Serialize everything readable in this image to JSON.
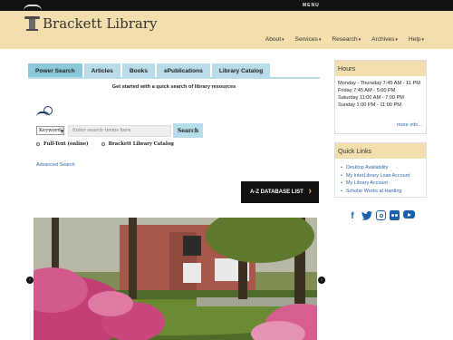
{
  "topbar": {
    "menu_label": "MENU"
  },
  "header": {
    "title": "Brackett Library"
  },
  "nav": [
    {
      "label": "About"
    },
    {
      "label": "Services"
    },
    {
      "label": "Research"
    },
    {
      "label": "Archives"
    },
    {
      "label": "Help"
    }
  ],
  "search": {
    "tabs": [
      {
        "label": "Power Search",
        "active": true
      },
      {
        "label": "Articles"
      },
      {
        "label": "Books"
      },
      {
        "label": "ePublications"
      },
      {
        "label": "Library Catalog"
      }
    ],
    "tagline": "Get started with a quick search of library resources",
    "field_select": "Keyword",
    "input_placeholder": "Enter search terms here",
    "button_label": "Search",
    "options": [
      {
        "label": "Full-Text (online)"
      },
      {
        "label": "Brackett Library Catalog"
      }
    ],
    "advanced_link": "Advanced Search"
  },
  "az_button": {
    "label": "A-Z DATABASE LIST"
  },
  "hours": {
    "heading": "Hours",
    "lines": [
      "Monday - Thursday 7:45 AM - 11 PM",
      "Friday 7:45 AM - 5:00 PM",
      "Saturday 11:00 AM - 7:00 PM",
      "Sunday 1:00 PM - 11:00 PM"
    ],
    "more_link": "more info..."
  },
  "quick_links": {
    "heading": "Quick Links",
    "items": [
      "Desktop Availability",
      "My InterLibrary Loan Account",
      "My Library Account",
      "Scholar Works at Harding"
    ]
  },
  "social": [
    "facebook-icon",
    "twitter-icon",
    "instagram-icon",
    "flickr-icon",
    "youtube-icon"
  ],
  "colors": {
    "header_bg": "#f3dfae",
    "tab_bg": "#b8dcea",
    "link": "#3366aa",
    "social": "#1a5fa8",
    "accent": "#e8a640"
  }
}
